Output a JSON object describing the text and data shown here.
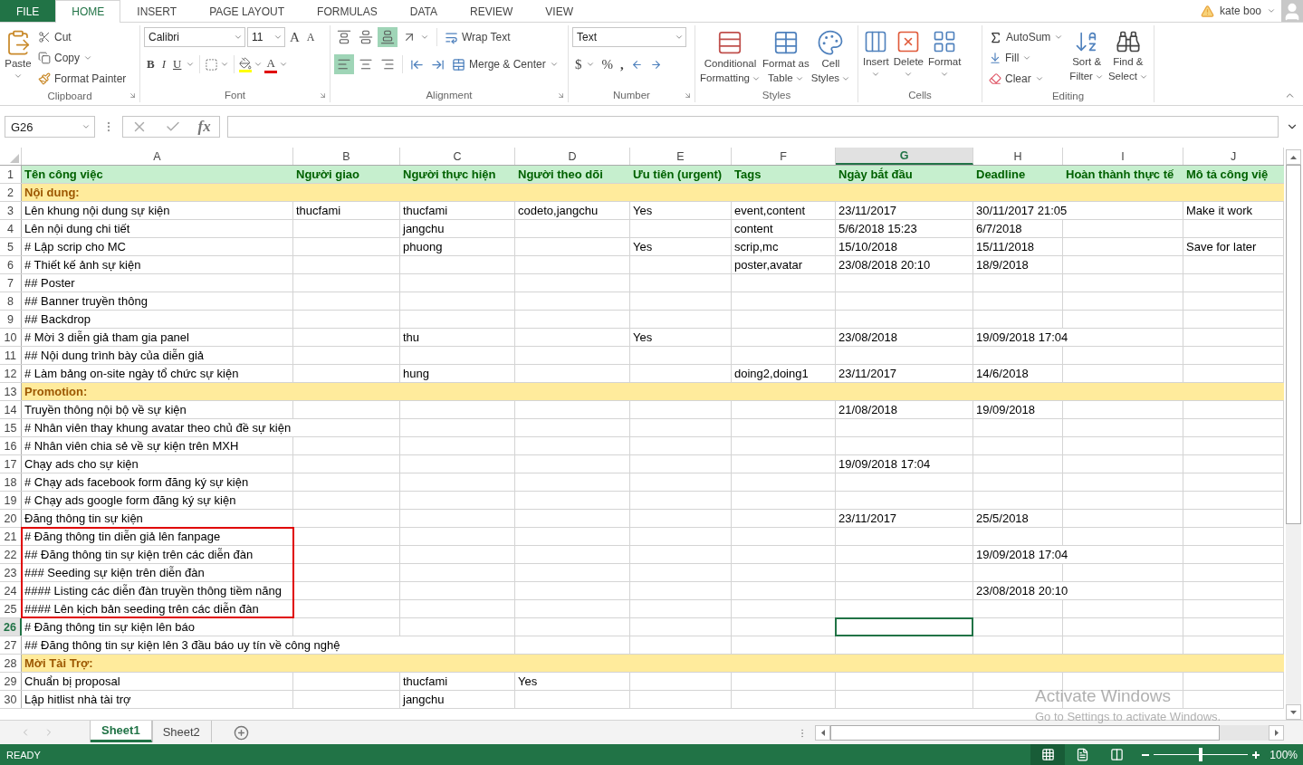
{
  "tabs": [
    {
      "label": "FILE",
      "kind": "file",
      "selected": false
    },
    {
      "label": "HOME",
      "kind": "tab",
      "selected": true
    },
    {
      "label": "INSERT",
      "kind": "tab",
      "selected": false
    },
    {
      "label": "PAGE LAYOUT",
      "kind": "tab",
      "selected": false
    },
    {
      "label": "FORMULAS",
      "kind": "tab",
      "selected": false
    },
    {
      "label": "DATA",
      "kind": "tab",
      "selected": false
    },
    {
      "label": "REVIEW",
      "kind": "tab",
      "selected": false
    },
    {
      "label": "VIEW",
      "kind": "tab",
      "selected": false
    }
  ],
  "user": {
    "name": "kate boo"
  },
  "ribbon": {
    "clipboard": {
      "label": "Clipboard",
      "paste": "Paste",
      "cut": "Cut",
      "copy": "Copy",
      "format_painter": "Format Painter"
    },
    "font": {
      "label": "Font",
      "font_name": "Calibri",
      "font_size": "11",
      "grow": "A",
      "shrink": "A",
      "bold": "B",
      "italic": "I",
      "underline": "U",
      "font_color": "A"
    },
    "alignment": {
      "label": "Alignment",
      "vertical": [
        {
          "kind": "top",
          "selected": false
        },
        {
          "kind": "middle",
          "selected": false
        },
        {
          "kind": "bottom",
          "selected": true
        }
      ],
      "horizontal": [
        {
          "kind": "left",
          "selected": true
        },
        {
          "kind": "center",
          "selected": false
        },
        {
          "kind": "right",
          "selected": false
        }
      ],
      "wrap_text": "Wrap Text",
      "merge": "Merge & Center"
    },
    "number": {
      "label": "Number",
      "format": "Text",
      "currency": "$",
      "percent": "%",
      "comma": ","
    },
    "styles": {
      "label": "Styles",
      "buttons": [
        {
          "kind": "conditional",
          "lines": [
            "Conditional",
            "Formatting"
          ]
        },
        {
          "kind": "table",
          "lines": [
            "Format as",
            "Table"
          ]
        },
        {
          "kind": "cell",
          "lines": [
            "Cell",
            "Styles"
          ]
        }
      ]
    },
    "cells": {
      "label": "Cells",
      "buttons": [
        {
          "kind": "insert",
          "label": "Insert"
        },
        {
          "kind": "delete",
          "label": "Delete"
        },
        {
          "kind": "format",
          "label": "Format"
        }
      ]
    },
    "editing": {
      "label": "Editing",
      "autosum": "AutoSum",
      "fill": "Fill",
      "clear": "Clear",
      "sort": [
        "Sort &",
        "Filter"
      ],
      "find": [
        "Find &",
        "Select"
      ]
    }
  },
  "formula_bar": {
    "name_box": "G26",
    "fx": "fx"
  },
  "columns": [
    {
      "label": "A",
      "selected": false
    },
    {
      "label": "B",
      "selected": false
    },
    {
      "label": "C",
      "selected": false
    },
    {
      "label": "D",
      "selected": false
    },
    {
      "label": "E",
      "selected": false
    },
    {
      "label": "F",
      "selected": false
    },
    {
      "label": "G",
      "selected": true
    },
    {
      "label": "H",
      "selected": false
    },
    {
      "label": "I",
      "selected": false
    },
    {
      "label": "J",
      "selected": false
    }
  ],
  "rows": [
    {
      "label": "1",
      "kind": "header",
      "selected": false,
      "boxed": false,
      "cells": [
        "Tên công việc",
        "Người giao",
        "Người thực hiện",
        "Người theo dõi",
        "Ưu tiên (urgent)",
        "Tags",
        "Ngày bắt đầu",
        "Deadline",
        "Hoàn thành thực tế",
        "Mô tả công việ"
      ]
    },
    {
      "label": "2",
      "kind": "section",
      "selected": false,
      "boxed": false,
      "cells": [
        "Nội dung:"
      ]
    },
    {
      "label": "3",
      "kind": "task",
      "selected": false,
      "boxed": false,
      "cells": [
        "Lên khung nội dung sự kiện",
        "thucfami",
        "thucfami",
        "codeto,jangchu",
        "Yes",
        "event,content",
        "23/11/2017",
        "30/11/2017 21:05",
        null,
        "Make it work"
      ]
    },
    {
      "label": "4",
      "kind": "task",
      "selected": false,
      "boxed": false,
      "cells": [
        "Lên nội dung chi tiết",
        null,
        "jangchu",
        null,
        null,
        "content",
        "5/6/2018 15:23",
        "6/7/2018"
      ]
    },
    {
      "label": "5",
      "kind": "task",
      "selected": false,
      "boxed": false,
      "cells": [
        "# Lập scrip cho MC",
        null,
        "phuong",
        null,
        "Yes",
        "scrip,mc",
        "15/10/2018",
        "15/11/2018",
        null,
        "Save for later"
      ]
    },
    {
      "label": "6",
      "kind": "task",
      "selected": false,
      "boxed": false,
      "cells": [
        "# Thiết kế ảnh sự kiện",
        null,
        null,
        null,
        null,
        "poster,avatar",
        "23/08/2018 20:10",
        "18/9/2018"
      ]
    },
    {
      "label": "7",
      "kind": "task",
      "selected": false,
      "boxed": false,
      "cells": [
        "## Poster"
      ]
    },
    {
      "label": "8",
      "kind": "task",
      "selected": false,
      "boxed": false,
      "cells": [
        "## Banner truyền thông"
      ]
    },
    {
      "label": "9",
      "kind": "task",
      "selected": false,
      "boxed": false,
      "cells": [
        "## Backdrop"
      ]
    },
    {
      "label": "10",
      "kind": "task",
      "selected": false,
      "boxed": false,
      "cells": [
        "# Mời 3 diễn giả tham gia panel",
        null,
        "thu",
        null,
        "Yes",
        null,
        "23/08/2018",
        "19/09/2018 17:04"
      ]
    },
    {
      "label": "11",
      "kind": "task",
      "selected": false,
      "boxed": false,
      "cells": [
        "## Nội dung trình bày của diễn giả"
      ]
    },
    {
      "label": "12",
      "kind": "task",
      "selected": false,
      "boxed": false,
      "cells": [
        "# Làm bảng on-site ngày tổ chức sự kiện",
        null,
        "hung",
        null,
        null,
        "doing2,doing1",
        "23/11/2017",
        "14/6/2018"
      ]
    },
    {
      "label": "13",
      "kind": "section",
      "selected": false,
      "boxed": false,
      "cells": [
        "Promotion:"
      ]
    },
    {
      "label": "14",
      "kind": "task",
      "selected": false,
      "boxed": false,
      "cells": [
        "Truyền thông nội bộ về sự kiện",
        null,
        null,
        null,
        null,
        null,
        "21/08/2018",
        "19/09/2018"
      ]
    },
    {
      "label": "15",
      "kind": "task",
      "selected": false,
      "boxed": false,
      "cells": [
        "# Nhân viên thay khung avatar theo chủ đề sự kiện"
      ]
    },
    {
      "label": "16",
      "kind": "task",
      "selected": false,
      "boxed": false,
      "cells": [
        "# Nhân viên chia sẻ về sự kiện trên MXH"
      ]
    },
    {
      "label": "17",
      "kind": "task",
      "selected": false,
      "boxed": false,
      "cells": [
        "Chạy ads cho sự kiện",
        null,
        null,
        null,
        null,
        null,
        "19/09/2018 17:04"
      ]
    },
    {
      "label": "18",
      "kind": "task",
      "selected": false,
      "boxed": false,
      "cells": [
        "# Chạy ads facebook form đăng ký sự kiện"
      ]
    },
    {
      "label": "19",
      "kind": "task",
      "selected": false,
      "boxed": false,
      "cells": [
        "# Chạy ads google form đăng ký sự kiện"
      ]
    },
    {
      "label": "20",
      "kind": "task",
      "selected": false,
      "boxed": false,
      "cells": [
        "Đăng thông tin sự kiện",
        null,
        null,
        null,
        null,
        null,
        "23/11/2017",
        "25/5/2018"
      ]
    },
    {
      "label": "21",
      "kind": "task",
      "selected": false,
      "boxed": true,
      "cells": [
        "# Đăng thông tin diễn giả lên fanpage"
      ]
    },
    {
      "label": "22",
      "kind": "task",
      "selected": false,
      "boxed": true,
      "cells": [
        "## Đăng thông tin sự kiện trên các diễn đàn",
        null,
        null,
        null,
        null,
        null,
        null,
        "19/09/2018 17:04"
      ]
    },
    {
      "label": "23",
      "kind": "task",
      "selected": false,
      "boxed": true,
      "cells": [
        "### Seeding sự kiện trên diễn đàn"
      ]
    },
    {
      "label": "24",
      "kind": "task",
      "selected": false,
      "boxed": true,
      "cells": [
        "#### Listing các diễn đàn truyền thông tiềm năng",
        null,
        null,
        null,
        null,
        null,
        null,
        "23/08/2018 20:10"
      ]
    },
    {
      "label": "25",
      "kind": "task",
      "selected": false,
      "boxed": true,
      "cells": [
        "#### Lên kịch bản seeding trên các diễn đàn"
      ]
    },
    {
      "label": "26",
      "kind": "task",
      "selected": true,
      "boxed": false,
      "cells": [
        "# Đăng thông tin sự kiện lên báo"
      ]
    },
    {
      "label": "27",
      "kind": "task",
      "selected": false,
      "boxed": false,
      "cells": [
        "## Đăng thông tin sự kiện lên 3 đầu báo uy tín về công nghệ"
      ]
    },
    {
      "label": "28",
      "kind": "section",
      "selected": false,
      "boxed": false,
      "cells": [
        "Mời Tài Trợ:"
      ]
    },
    {
      "label": "29",
      "kind": "task",
      "selected": false,
      "boxed": false,
      "cells": [
        "Chuẩn bị proposal",
        null,
        "thucfami",
        "Yes"
      ]
    },
    {
      "label": "30",
      "kind": "task",
      "selected": false,
      "boxed": false,
      "cells": [
        "Lập hitlist nhà tài trợ",
        null,
        "jangchu"
      ]
    }
  ],
  "sheets": [
    {
      "label": "Sheet1",
      "selected": true
    },
    {
      "label": "Sheet2",
      "selected": false
    }
  ],
  "status_bar": {
    "status": "READY",
    "views": [
      {
        "kind": "normal",
        "selected": true
      },
      {
        "kind": "page-layout",
        "selected": false
      },
      {
        "kind": "page-break",
        "selected": false
      }
    ],
    "zoom": {
      "level": 0.5,
      "reading": "100%"
    }
  },
  "os_notice": {
    "title": "Activate Windows",
    "text": "Go to Settings to activate Windows."
  }
}
